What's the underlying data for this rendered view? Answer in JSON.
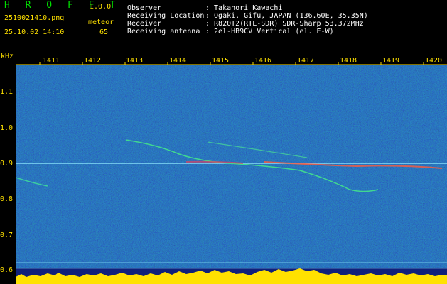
{
  "header": {
    "app_title": "H R O F F T",
    "version": "1.0.0",
    "filename": "2510021410.png",
    "detection_label": "meteor",
    "datetime": "25.10.02 14:10",
    "count": "65"
  },
  "info": {
    "labels": [
      "Observer",
      "Receiving Location",
      "Receiver",
      "Receiving antenna"
    ],
    "values": [
      ": Takanori Kawachi",
      ": Ogaki, Gifu, JAPAN (136.60E, 35.35N)",
      ": R820T2(RTL-SDR) SDR-Sharp 53.372MHz",
      ": 2el-HB9CV Vertical (el. E-W)"
    ]
  },
  "axes": {
    "y_unit": "kHz",
    "x_ticks": [
      "1411",
      "1412",
      "1413",
      "1414",
      "1415",
      "1416",
      "1417",
      "1418",
      "1419",
      "1420"
    ],
    "y_ticks": [
      "1.1",
      "1.0",
      "0.9",
      "0.8",
      "0.7",
      "0.6"
    ]
  },
  "colors": {
    "header_text": "#00e000",
    "axis_text": "#ffe100",
    "background": "#10207a",
    "spectrum": "#ffe100"
  }
}
